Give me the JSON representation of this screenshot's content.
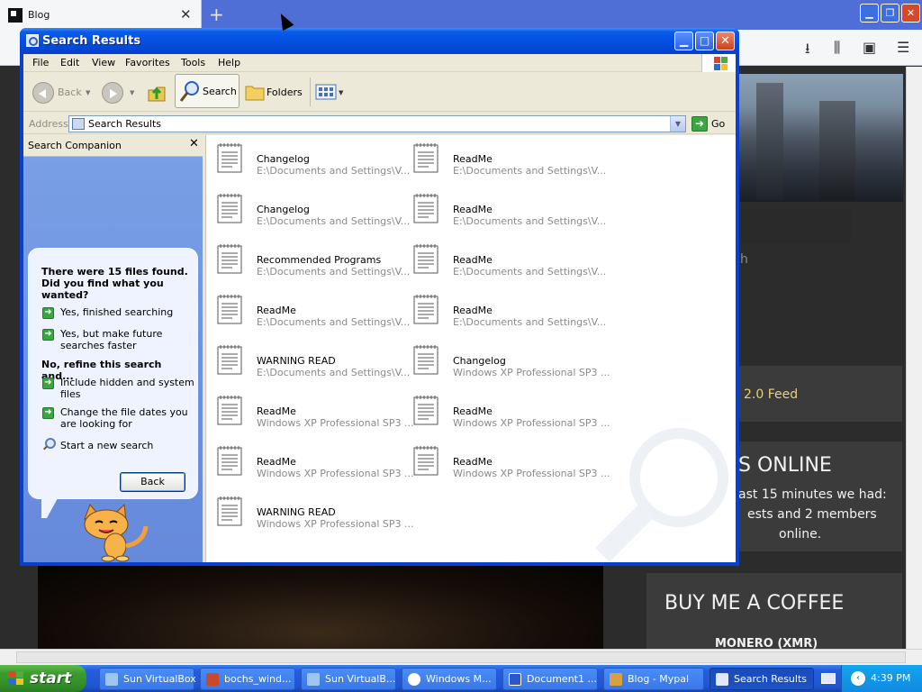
{
  "browser": {
    "tab_title": "Blog",
    "bg_feed": "2.0 Feed",
    "bg_online_title": "S ONLINE",
    "bg_online_1": "ast 15 minutes we had:",
    "bg_online_2": "ests and 2 members",
    "bg_online_3": "online.",
    "bg_coffee": "BUY ME A COFFEE",
    "bg_monero": "MONERO (XMR)",
    "bg_search": "h"
  },
  "window": {
    "title": "Search Results",
    "menu": [
      "File",
      "Edit",
      "View",
      "Favorites",
      "Tools",
      "Help"
    ],
    "toolbar": {
      "back": "Back",
      "search": "Search",
      "folders": "Folders"
    },
    "address": {
      "label": "Address",
      "value": "Search Results",
      "go": "Go"
    }
  },
  "companion": {
    "title": "Search Companion",
    "question": "There were 15 files found. Did you find what you wanted?",
    "options1": [
      "Yes, finished searching",
      "Yes, but make future searches faster"
    ],
    "refine": "No, refine this search and...",
    "options2": [
      "Include hidden and system files",
      "Change the file dates you are looking for"
    ],
    "new_search": "Start a new search",
    "back_button": "Back"
  },
  "results": [
    {
      "name": "Changelog",
      "path": "E:\\Documents and Settings\\V..."
    },
    {
      "name": "ReadMe",
      "path": "E:\\Documents and Settings\\V..."
    },
    {
      "name": "Changelog",
      "path": "E:\\Documents and Settings\\V..."
    },
    {
      "name": "ReadMe",
      "path": "E:\\Documents and Settings\\V..."
    },
    {
      "name": "Recommended Programs",
      "path": "E:\\Documents and Settings\\V..."
    },
    {
      "name": "ReadMe",
      "path": "E:\\Documents and Settings\\V..."
    },
    {
      "name": "ReadMe",
      "path": "E:\\Documents and Settings\\V..."
    },
    {
      "name": "ReadMe",
      "path": "E:\\Documents and Settings\\V..."
    },
    {
      "name": "WARNING READ",
      "path": "E:\\Documents and Settings\\V..."
    },
    {
      "name": "Changelog",
      "path": "Windows XP Professional SP3 ..."
    },
    {
      "name": "ReadMe",
      "path": "Windows XP Professional SP3 ..."
    },
    {
      "name": "ReadMe",
      "path": "Windows XP Professional SP3 ..."
    },
    {
      "name": "ReadMe",
      "path": "Windows XP Professional SP3 ..."
    },
    {
      "name": "ReadMe",
      "path": "Windows XP Professional SP3 ..."
    },
    {
      "name": "WARNING READ",
      "path": "Windows XP Professional SP3 ..."
    }
  ],
  "taskbar": {
    "start": "start",
    "tasks": [
      "Sun VirtualBox",
      "bochs_wind...",
      "Sun VirtualB...",
      "Windows M...",
      "Document1 ...",
      "Blog - Mypal",
      "Search Results"
    ],
    "clock": "4:39 PM"
  },
  "colors": {
    "xp_blue": "#0a3fd0",
    "start_green": "#3c9c2f",
    "pane_blue": "#6b92e0"
  }
}
